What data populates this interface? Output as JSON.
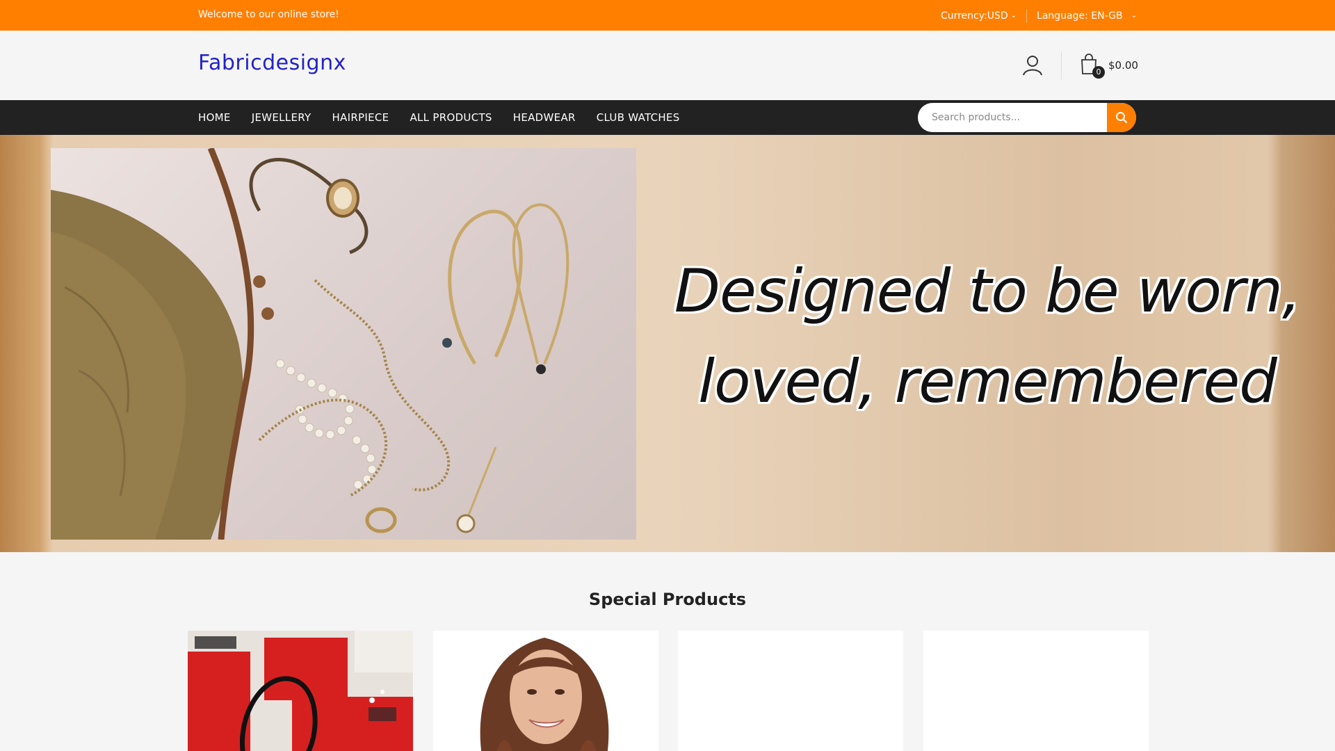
{
  "topbar": {
    "welcome": "Welcome to our online store!",
    "currency_label": "Currency:USD",
    "language_label": "Language: EN-GB"
  },
  "header": {
    "logo_text": "Fabricdesignx",
    "cart_count": "0",
    "cart_total": "$0.00"
  },
  "nav": {
    "items": [
      "HOME",
      "JEWELLERY",
      "HAIRPIECE",
      "ALL PRODUCTS",
      "HEADWEAR",
      "CLUB WATCHES"
    ]
  },
  "search": {
    "placeholder": "Search products..."
  },
  "banner": {
    "line1": "Designed to be worn,",
    "line2": "loved, remembered"
  },
  "special": {
    "title": "Special Products"
  },
  "colors": {
    "accent": "#ff7f00",
    "nav_bg": "#222222",
    "logo": "#2222c8"
  }
}
